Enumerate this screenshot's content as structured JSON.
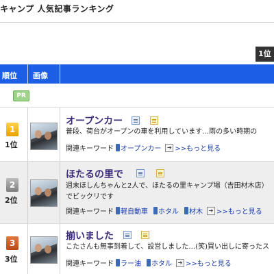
{
  "header": {
    "title": "キャンプ 人気記事ランキング"
  },
  "pager": {
    "current_label": "1位"
  },
  "columns": {
    "rank": "順位",
    "image": "画像"
  },
  "pr_label": "PR",
  "keyword_prefix": "関連キーワード",
  "more_label": ">>もっと見る",
  "colors": {
    "header_bar": "#1c5fe6",
    "title_link": "#3c2a7a",
    "keyword_link": "#1a3fa6"
  },
  "articles": [
    {
      "rank_num": "1",
      "rank_label": "1位",
      "medal": "gold",
      "title": "オープンカー",
      "summary": "普段、荷台がオープンの車を利用しています…雨の多い時期の",
      "keywords": [
        "オープンカー"
      ]
    },
    {
      "rank_num": "2",
      "rank_label": "2位",
      "medal": "silver",
      "title": "ほたるの里で",
      "summary": "週末ほしんちゃんと2人で、ほたるの里キャンプ場（吉田材木店）でビックリです",
      "keywords": [
        "軽自動車",
        "ホタル",
        "材木"
      ]
    },
    {
      "rank_num": "3",
      "rank_label": "3位",
      "medal": "bronze",
      "title": "揃いました",
      "summary": "こたさんも無事到着して、設営しました…(笑)買い出しに寄ったス",
      "keywords": [
        "ラー油",
        "ホタル"
      ]
    }
  ]
}
